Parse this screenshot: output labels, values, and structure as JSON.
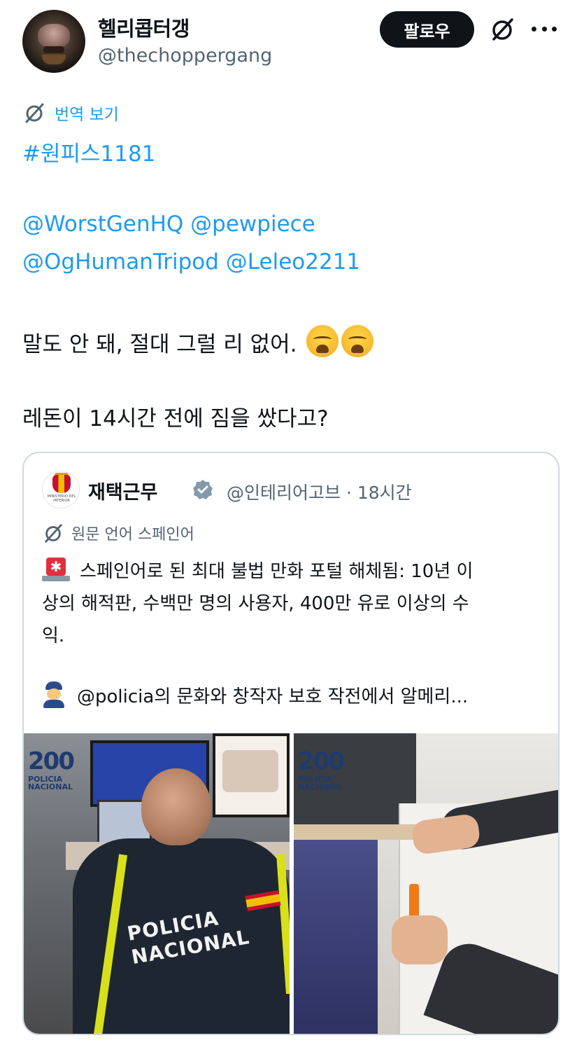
{
  "author": {
    "display_name": "헬리콥터갱",
    "handle": "@thechoppergang",
    "follow_label": "팔로우"
  },
  "icons": {
    "avatar": "avatar",
    "grok": "grok-icon",
    "more": "more-icon",
    "translate": "translate-icon",
    "verified": "verified-badge-icon"
  },
  "translate_label": "번역 보기",
  "post": {
    "hashtag": "#원피스1181",
    "mentions_line1": [
      "@WorstGenHQ",
      "@pewpiece"
    ],
    "mentions_line2": [
      "@OgHumanTripod",
      "@Leleo2211"
    ],
    "sentence1": "말도 안 돼, 절대 그럴 리 없어.",
    "sentence2": "레돈이 14시간 전에 짐을 쌌다고?"
  },
  "quote": {
    "name": "재택근무",
    "handle": "@인테리어고브",
    "separator": "·",
    "time": "18시간",
    "avatar_caption": "MINISTERIO DEL INTERIOR",
    "translate_label": "원문 언어 스페인어",
    "line1": "스페인어로 된 최대 불법 만화 포털 해체됨: 10년 이",
    "line2": "상의 해적판, 수백만 명의 사용자, 400만 유로 이상의 수",
    "line3": "익.",
    "line4_mention": "@policia",
    "line4_rest": "의 문화와 창작자 보호 작전에서 알메리...",
    "photos": [
      {
        "logo_number": "200",
        "logo_line1": "POLICIA",
        "logo_line2": "NACIONAL",
        "vest_line1": "POLICIA",
        "vest_line2": "NACIONAL"
      },
      {
        "logo_number": "200",
        "logo_line1": "POLICIA",
        "logo_line2": "NACIONAL"
      }
    ]
  },
  "colors": {
    "link": "#1d9bf0",
    "muted": "#536471",
    "follow_bg": "#0f1419",
    "border": "#cfd9de"
  }
}
